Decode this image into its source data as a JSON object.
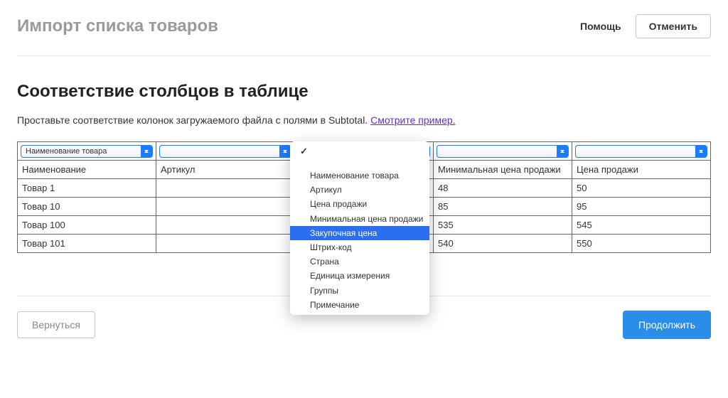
{
  "header": {
    "title": "Импорт списка товаров",
    "help_label": "Помощь",
    "cancel_label": "Отменить"
  },
  "section": {
    "heading": "Соответствие столбцов в таблице",
    "hint_text": "Проставьте соответствие колонок загружаемого файла с полями в Subtotal. ",
    "hint_link": "Смотрите пример."
  },
  "columns": {
    "selects": [
      {
        "value": "Наименование товара"
      },
      {
        "value": ""
      },
      {
        "value": ""
      },
      {
        "value": ""
      },
      {
        "value": ""
      }
    ],
    "headers": [
      "Наименование",
      "Артикул",
      "",
      "Минимальная цена продажи",
      "Цена продажи"
    ]
  },
  "rows": [
    {
      "c0": "Товар 1",
      "c1": "",
      "c2": "",
      "c3": "48",
      "c4": "50"
    },
    {
      "c0": "Товар 10",
      "c1": "",
      "c2": "",
      "c3": "85",
      "c4": "95"
    },
    {
      "c0": "Товар 100",
      "c1": "",
      "c2": "",
      "c3": "535",
      "c4": "545"
    },
    {
      "c0": "Товар 101",
      "c1": "",
      "c2": "",
      "c3": "540",
      "c4": "550"
    }
  ],
  "dropdown": {
    "checkmark": "✓",
    "items": [
      "Наименование товара",
      "Артикул",
      "Цена продажи",
      "Минимальная цена продажи",
      "Закупочная цена",
      "Штрих-код",
      "Страна",
      "Единица измерения",
      "Группы",
      "Примечание"
    ],
    "selected_index": 4
  },
  "footer": {
    "back_label": "Вернуться",
    "continue_label": "Продолжить"
  }
}
